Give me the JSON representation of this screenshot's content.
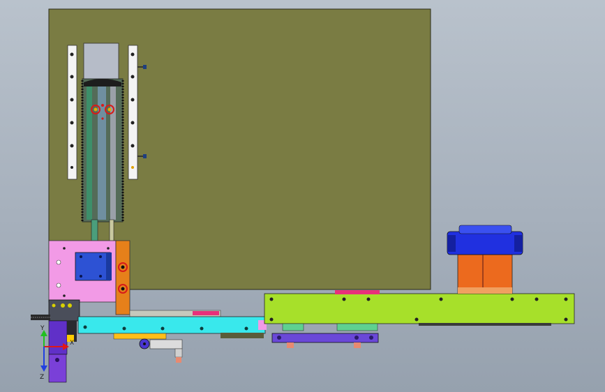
{
  "viewport": {
    "background_top": "#b9c2cc",
    "background_bottom": "#96a1ae"
  },
  "colors": {
    "plate": "#7a7c43",
    "pink_block": "#f29ae6",
    "blue_block": "#2d52d4",
    "orange_bar": "#e6801a",
    "cyan_rail": "#39e8ec",
    "lime_base": "#a7e02a",
    "motor_orange": "#ec6a1e",
    "motor_blue": "#2030e0",
    "purple_link": "#6a48d8",
    "rail_white": "#f4f4f4",
    "slider_green": "#4b9e7c"
  },
  "triad": {
    "x_label": "X",
    "y_label": "Y",
    "z_label": "Z"
  }
}
